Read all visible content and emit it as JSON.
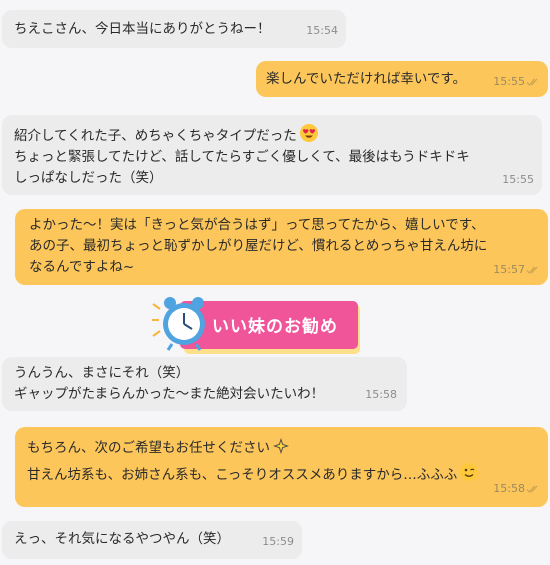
{
  "messages": [
    {
      "dir": "in",
      "text": "ちえこさん、今日本当にありがとうねー！",
      "time": "15:54"
    },
    {
      "dir": "out",
      "text": "楽しんでいただければ幸いです。",
      "time": "15:55"
    },
    {
      "dir": "in",
      "text": "紹介してくれた子、めちゃくちゃタイプだった",
      "text2": "ちょっと緊張してたけど、話してたらすごく優しくて、最後はもうドキドキ\nしっぱなしだった（笑）",
      "time": "15:55"
    },
    {
      "dir": "out",
      "text": "よかった〜！実は「きっと気が合うはず」って思ってたから、嬉しいです、\nあの子、最初ちょっと恥ずかしがり屋だけど、慣れるとめっちゃ甘えん坊に\nなるんですよね~",
      "time": "15:57"
    },
    {
      "dir": "in",
      "text": "うんうん、まさにそれ（笑）\nギャップがたまらんかった～また絶対会いたいわ！",
      "time": "15:58"
    },
    {
      "dir": "out",
      "text": "もちろん、次のご希望もお任せください",
      "text2": "甘えん坊系も、お姉さん系も、こっそりオススメありますから…ふふふ",
      "time": "15:58"
    },
    {
      "dir": "in",
      "text": "えっ、それ気になるやつやん（笑）",
      "time": "15:59"
    }
  ],
  "sticker": {
    "label": "いい妹のお勧め",
    "icon": "alarm-clock-icon"
  },
  "colors": {
    "outgoing": "#fcc65b",
    "incoming": "#ececed",
    "background": "#f6f5f8",
    "sticker_pink": "#f0559a"
  }
}
